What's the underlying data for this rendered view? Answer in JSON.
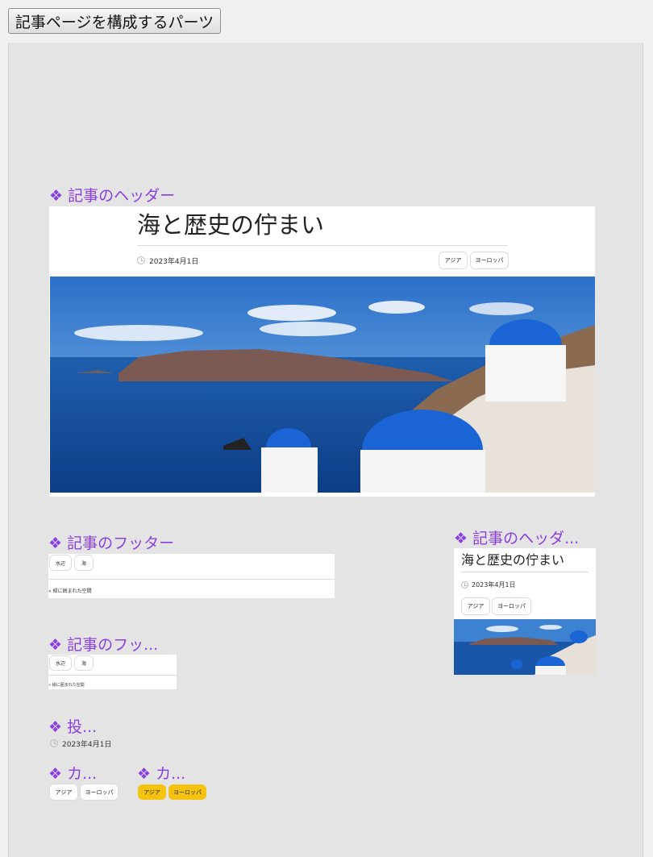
{
  "toolbar": {
    "button_label": "記事ページを構成するパーツ"
  },
  "panel_icon": "◆✦ four-diamond-icon",
  "panels": {
    "header_main": {
      "title": "❖ 記事のヘッダー"
    },
    "footer_main": {
      "title": "❖ 記事のフッター"
    },
    "header_small": {
      "title": "❖ 記事のヘッダ..."
    },
    "footer_small": {
      "title": "❖ 記事のフッ..."
    },
    "post_meta": {
      "title": "❖ 投..."
    },
    "category_a": {
      "title": "❖ カ..."
    },
    "category_b": {
      "title": "❖ カ..."
    }
  },
  "article": {
    "title": "海と歴史の佇まい",
    "date": "2023年4月1日",
    "categories": [
      "アジア",
      "ヨーロッパ"
    ],
    "tags": [
      "水辺",
      "海"
    ],
    "prev_link": "« 緑に囲まれた空間"
  },
  "colors": {
    "accent": "#8b3fe0",
    "tag_highlight": "#f6c210"
  }
}
